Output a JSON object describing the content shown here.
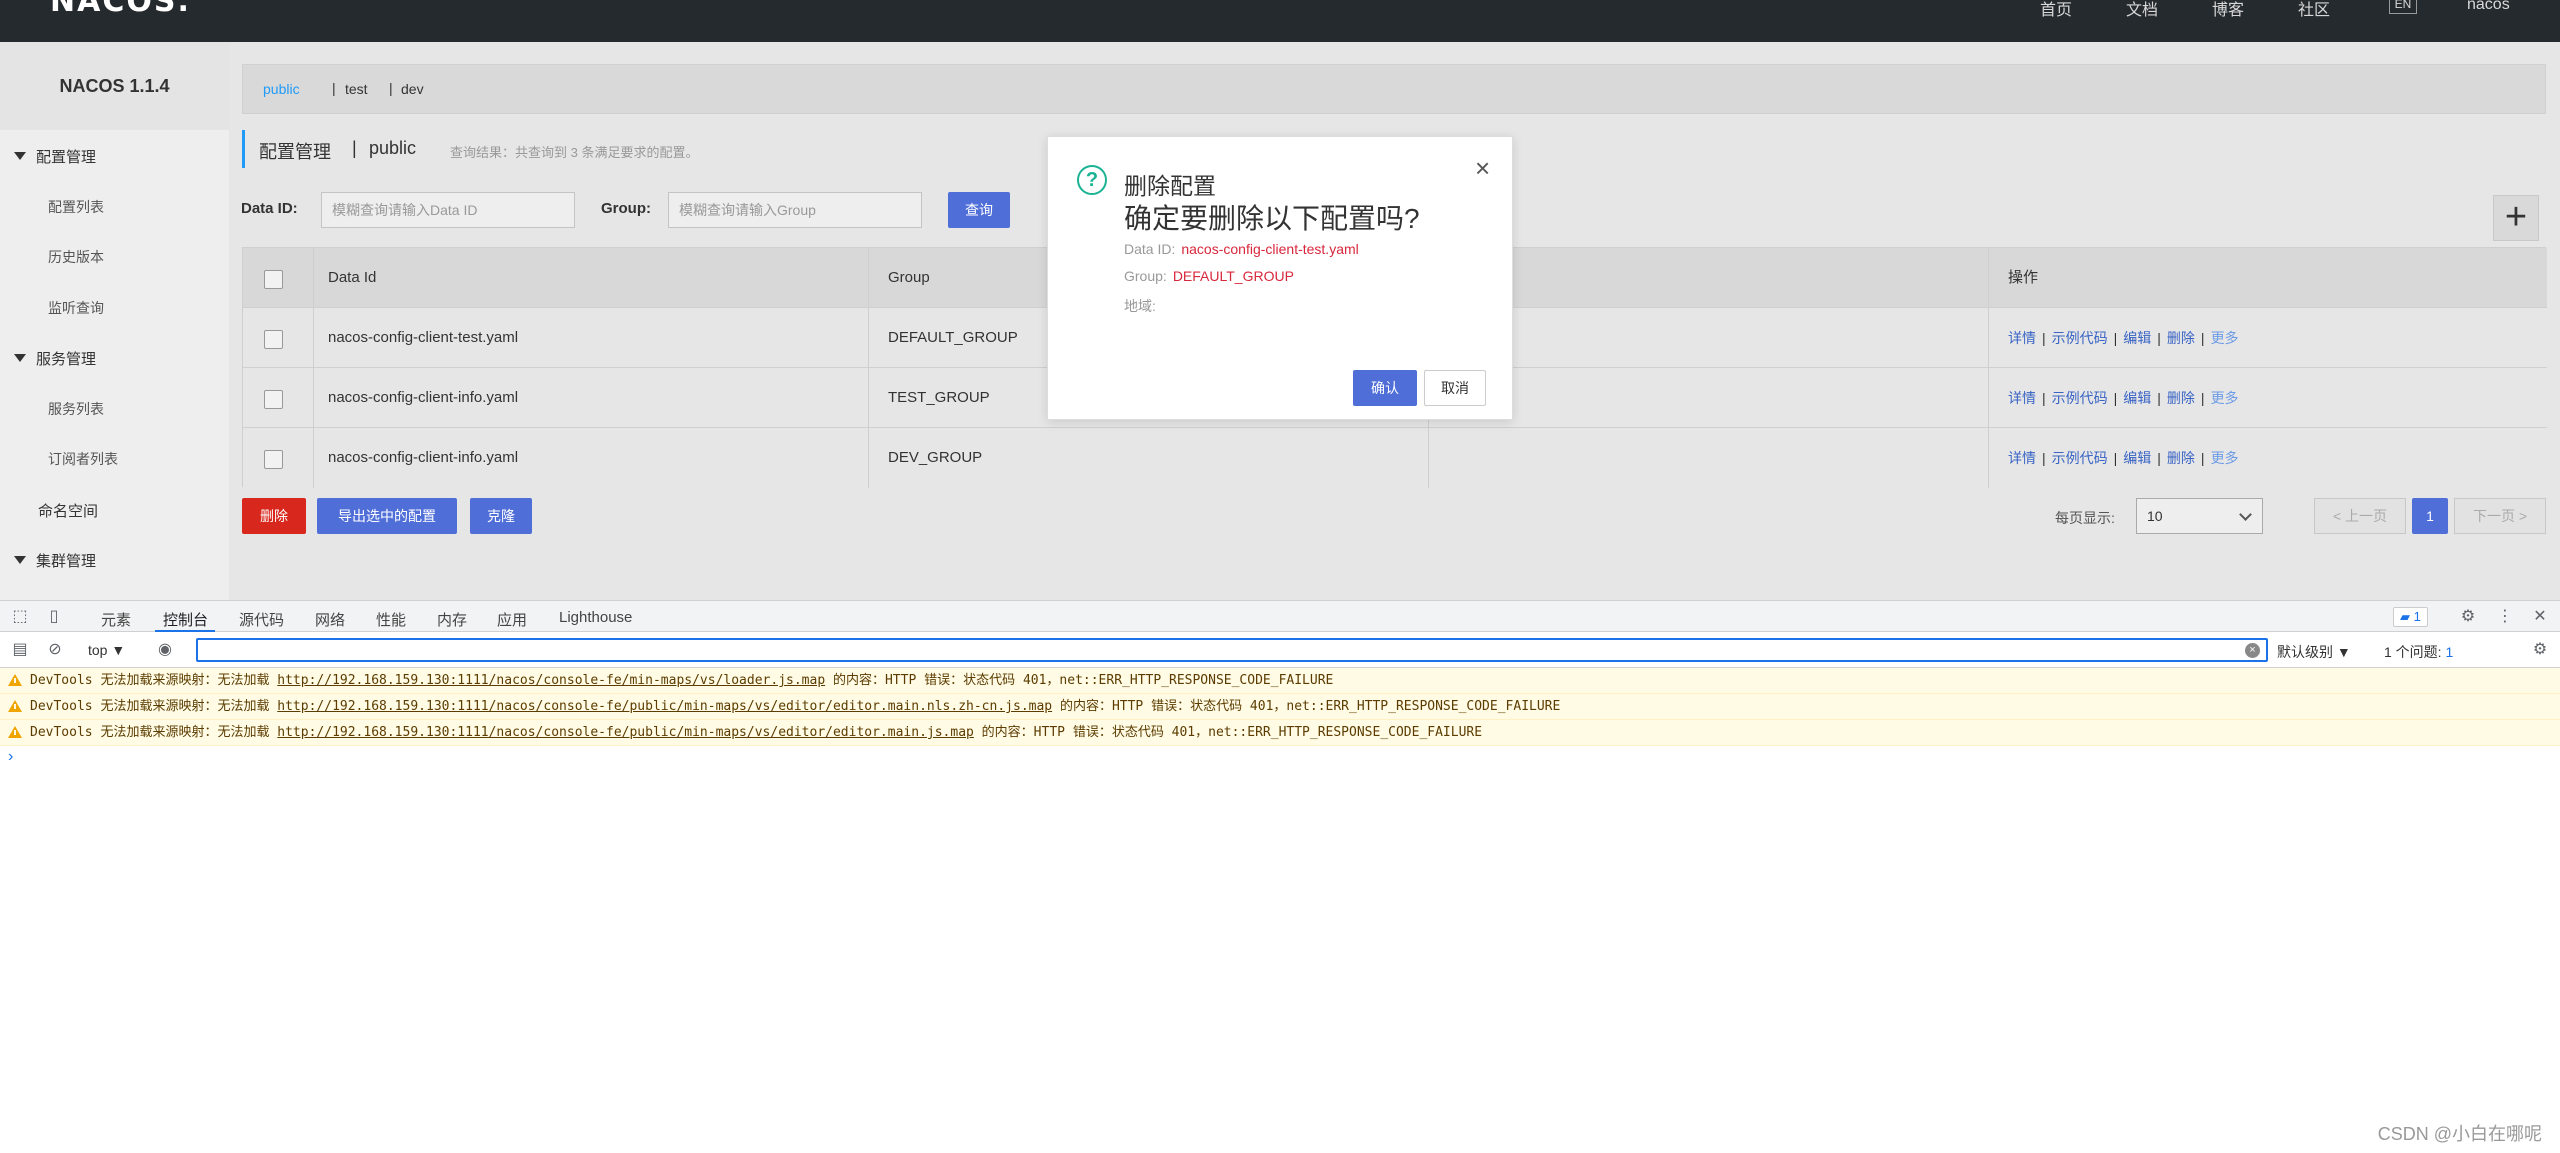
{
  "nav": {
    "logo": "NACOS.",
    "links": [
      "首页",
      "文档",
      "博客",
      "社区"
    ],
    "lang": "EN",
    "user": "nacos"
  },
  "sidebar": {
    "title": "NACOS 1.1.4",
    "groups": [
      {
        "label": "配置管理",
        "items": [
          "配置列表",
          "历史版本",
          "监听查询"
        ]
      },
      {
        "label": "服务管理",
        "items": [
          "服务列表",
          "订阅者列表"
        ]
      },
      {
        "label": "命名空间"
      },
      {
        "label": "集群管理"
      }
    ]
  },
  "namespaces": [
    "public",
    "test",
    "dev"
  ],
  "header": {
    "title": "配置管理",
    "separator": "|",
    "namespace": "public",
    "hint": "查询结果：共查询到 3 条满足要求的配置。"
  },
  "search": {
    "data_id_label": "Data ID:",
    "data_id_placeholder": "模糊查询请输入Data ID",
    "group_label": "Group:",
    "group_placeholder": "模糊查询请输入Group",
    "query_button": "查询",
    "add_button": "+"
  },
  "table": {
    "columns": [
      "Data Id",
      "Group",
      "",
      "操作"
    ],
    "rows": [
      {
        "data_id": "nacos-config-client-test.yaml",
        "group": "DEFAULT_GROUP"
      },
      {
        "data_id": "nacos-config-client-info.yaml",
        "group": "TEST_GROUP"
      },
      {
        "data_id": "nacos-config-client-info.yaml",
        "group": "DEV_GROUP"
      }
    ],
    "ops": [
      "详情",
      "示例代码",
      "编辑",
      "删除",
      "更多"
    ]
  },
  "actions": {
    "delete": "删除",
    "export": "导出选中的配置",
    "clone": "克隆"
  },
  "pagination": {
    "per_page_label": "每页显示:",
    "per_page_value": "10",
    "prev": "< 上一页",
    "current": "1",
    "next": "下一页 >"
  },
  "modal": {
    "title": "删除配置",
    "question": "确定要删除以下配置吗?",
    "data_id_label": "Data ID:",
    "data_id_value": "nacos-config-client-test.yaml",
    "group_label": "Group:",
    "group_value": "DEFAULT_GROUP",
    "region_label": "地域:",
    "ok": "确认",
    "cancel": "取消",
    "close": "×"
  },
  "devtools": {
    "tabs": [
      "元素",
      "控制台",
      "源代码",
      "网络",
      "性能",
      "内存",
      "应用",
      "Lighthouse"
    ],
    "active_tab": "控制台",
    "issues_badge": "1",
    "context": "top ▼",
    "level": "默认级别 ▼",
    "issues_text": "1 个问题:",
    "issues_count": "1",
    "logs": [
      {
        "prefix": "DevTools 无法加载来源映射：无法加载 ",
        "url": "http://192.168.159.130:1111/nacos/console-fe/min-maps/vs/loader.js.map",
        "suffix": " 的内容：HTTP 错误：状态代码 401，net::ERR_HTTP_RESPONSE_CODE_FAILURE"
      },
      {
        "prefix": "DevTools 无法加载来源映射：无法加载 ",
        "url": "http://192.168.159.130:1111/nacos/console-fe/public/min-maps/vs/editor/editor.main.nls.zh-cn.js.map",
        "suffix": " 的内容：HTTP 错误：状态代码 401，net::ERR_HTTP_RESPONSE_CODE_FAILURE"
      },
      {
        "prefix": "DevTools 无法加载来源映射：无法加载 ",
        "url": "http://192.168.159.130:1111/nacos/console-fe/public/min-maps/vs/editor/editor.main.js.map",
        "suffix": " 的内容：HTTP 错误：状态代码 401，net::ERR_HTTP_RESPONSE_CODE_FAILURE"
      }
    ],
    "prompt": "›"
  },
  "watermark": "CSDN @小白在哪呢"
}
